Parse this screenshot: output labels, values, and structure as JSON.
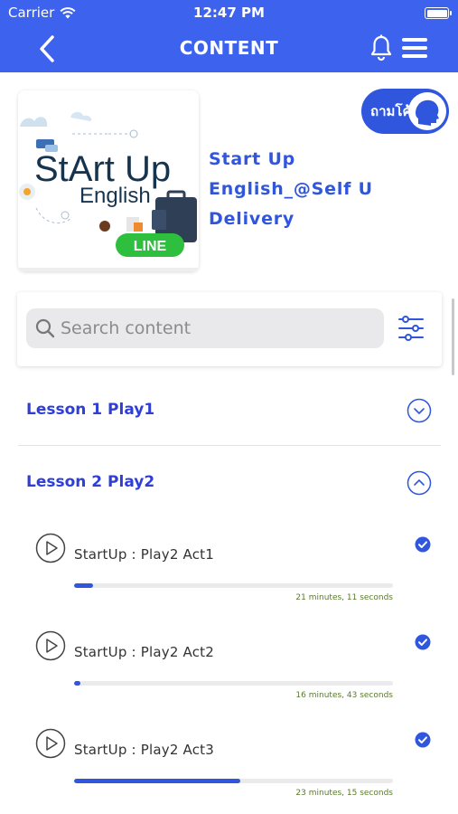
{
  "status": {
    "carrier": "Carrier",
    "time": "12:47 PM"
  },
  "nav": {
    "title": "CONTENT"
  },
  "course": {
    "cover_title_1": "StArt Up",
    "cover_title_2": "English",
    "cover_badge": "LINE",
    "title": "Start Up English_@Self U Delivery"
  },
  "ask_button": {
    "label": "ถามโค้ช"
  },
  "search": {
    "placeholder": "Search content",
    "value": ""
  },
  "lessons": [
    {
      "title": "Lesson 1 Play1",
      "expanded": false
    },
    {
      "title": "Lesson 2 Play2",
      "expanded": true,
      "items": [
        {
          "name": "StartUp : Play2  Act1",
          "duration": "21 minutes, 11 seconds",
          "progress": 0.06,
          "completed": true
        },
        {
          "name": "StartUp : Play2  Act2",
          "duration": "16 minutes, 43 seconds",
          "progress": 0.02,
          "completed": true
        },
        {
          "name": "StartUp : Play2  Act3",
          "duration": "23 minutes, 15 seconds",
          "progress": 0.52,
          "completed": true
        }
      ]
    }
  ],
  "colors": {
    "header": "#3d63ee",
    "accent": "#2f56dc",
    "lesson_title": "#2f3fd6",
    "duration_text": "#5a7a2a"
  }
}
